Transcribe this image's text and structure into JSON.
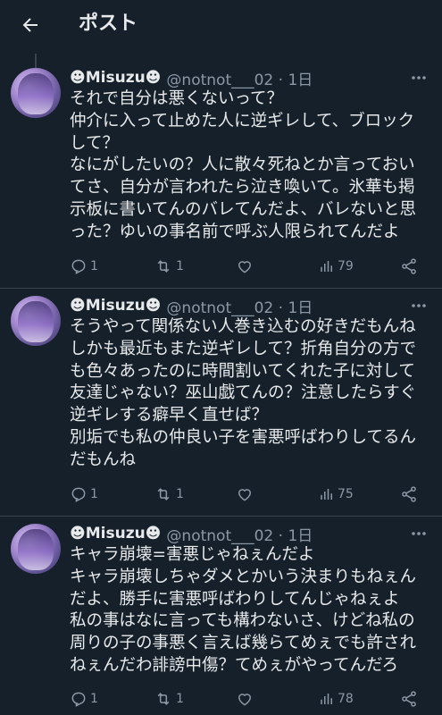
{
  "header": {
    "title": "ポスト"
  },
  "posts": [
    {
      "name": "☻Misuzu☻",
      "handle": "@notnot___02 · 1日",
      "lines": [
        "それで自分は悪くないって？",
        "仲介に入って止めた人に逆ギレして、ブロック",
        "して？",
        "なにがしたいの？人に散々死ねとか言っておい",
        "てさ、自分が言われたら泣き喚いて。氷華も掲",
        "示板に書いてんのバレてんだよ、バレないと思",
        "った？ゆいの事名前で呼ぶ人限られてんだよ"
      ],
      "replies": "1",
      "reposts": "1",
      "likes": "",
      "views": "79"
    },
    {
      "name": "☻Misuzu☻",
      "handle": "@notnot___02 · 1日",
      "lines": [
        "そうやって関係ない人巻き込むの好きだもんね",
        "しかも最近もまた逆ギレして？折角自分の方で",
        "も色々あったのに時間割いてくれた子に対して",
        "友達じゃない？巫山戯てんの？注意したらすぐ",
        "逆ギレする癖早く直せば？",
        "別垢でも私の仲良い子を害悪呼ばわりしてるん",
        "だもんね"
      ],
      "replies": "1",
      "reposts": "1",
      "likes": "",
      "views": "75"
    },
    {
      "name": "☻Misuzu☻",
      "handle": "@notnot___02 · 1日",
      "lines": [
        "キャラ崩壊=害悪じゃねぇんだよ",
        "キャラ崩壊しちゃダメとかいう決まりもねぇん",
        "だよ、勝手に害悪呼ばわりしてんじゃねぇよ",
        "私の事はなに言っても構わないさ、けどね私の",
        "周りの子の事悪く言えば幾らてめぇでも許され",
        "ねぇんだわ誹謗中傷？てめぇがやってんだろ"
      ],
      "replies": "1",
      "reposts": "1",
      "likes": "",
      "views": "78"
    }
  ],
  "icons": {
    "back": "arrow-left-icon",
    "more": "more-dots-icon",
    "reply": "reply-icon",
    "repost": "repost-icon",
    "like": "heart-icon",
    "views": "views-bar-chart-icon",
    "share": "share-icon"
  },
  "colors": {
    "background": "#15202b",
    "text": "#e7e9ea",
    "muted": "#8b98a5",
    "divider": "#38444d"
  }
}
